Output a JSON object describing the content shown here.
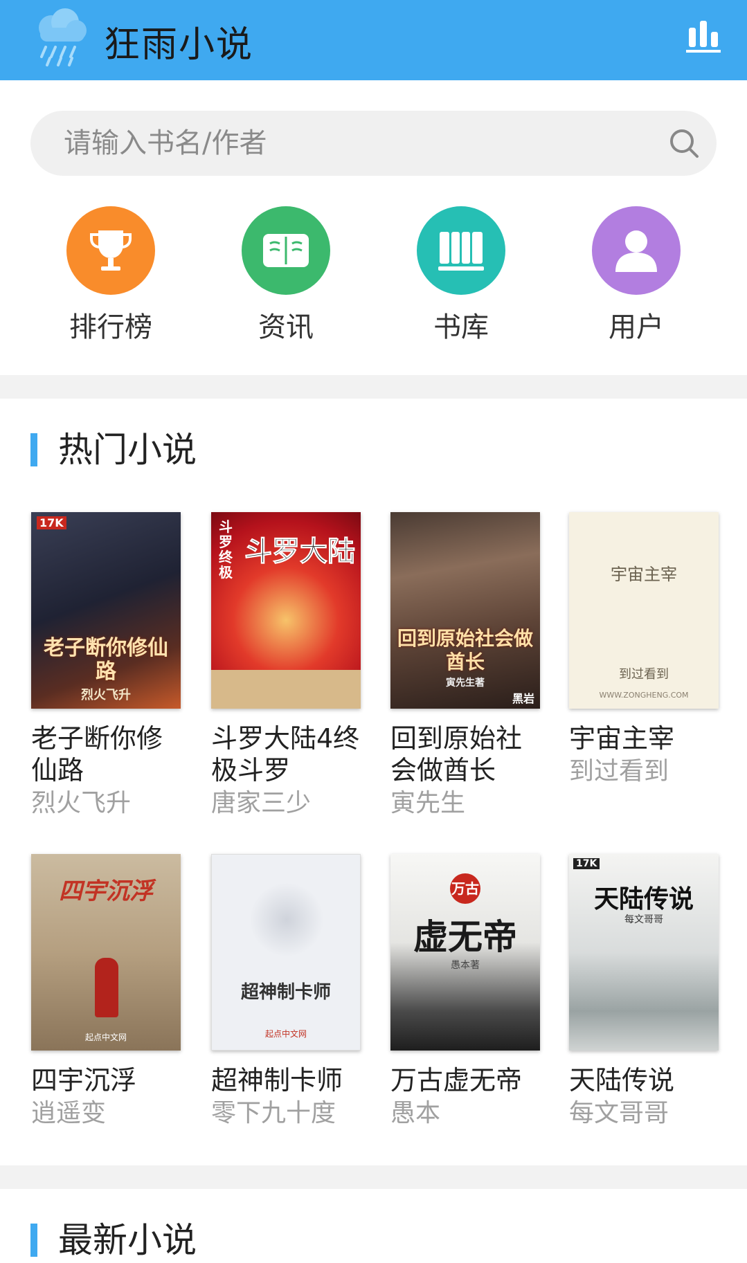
{
  "app": {
    "title": "狂雨小说"
  },
  "search": {
    "placeholder": "请输入书名/作者"
  },
  "nav": [
    {
      "label": "排行榜",
      "icon": "trophy-icon",
      "color": "#f98c2b"
    },
    {
      "label": "资讯",
      "icon": "book-open-icon",
      "color": "#3cb96d"
    },
    {
      "label": "书库",
      "icon": "bookshelf-icon",
      "color": "#26bfb4"
    },
    {
      "label": "用户",
      "icon": "user-icon",
      "color": "#b27ee0"
    }
  ],
  "sections": {
    "hot": "热门小说",
    "latest": "最新小说"
  },
  "hot_books": [
    {
      "title": "老子断你修仙路",
      "author": "烈火飞升",
      "cover_text": "老子断你修仙路",
      "cover_sub": "烈火飞升",
      "cover_badge": "17K"
    },
    {
      "title": "斗罗大陆4终极斗罗",
      "author": "唐家三少",
      "cover_text": "斗罗大陆",
      "cover_sub": "斗罗 终极",
      "cover_badge": ""
    },
    {
      "title": "回到原始社会做酋长",
      "author": "寅先生",
      "cover_text": "回到原始社会做酋长",
      "cover_sub": "寅先生著",
      "cover_badge": "黑岩"
    },
    {
      "title": "宇宙主宰",
      "author": "到过看到",
      "cover_text": "宇宙主宰",
      "cover_sub": "到过看到",
      "cover_badge": "WWW.ZONGHENG.COM"
    },
    {
      "title": "四宇沉浮",
      "author": "逍遥变",
      "cover_text": "四宇沉浮",
      "cover_sub": "起点中文网",
      "cover_badge": ""
    },
    {
      "title": "超神制卡师",
      "author": "零下九十度",
      "cover_text": "超神制卡师",
      "cover_sub": "起点中文网",
      "cover_badge": ""
    },
    {
      "title": "万古虚无帝",
      "author": "愚本",
      "cover_text": "虚无帝",
      "cover_sub": "万古",
      "cover_badge": "愚本著"
    },
    {
      "title": "天陆传说",
      "author": "每文哥哥",
      "cover_text": "天陆传说",
      "cover_sub": "每文哥哥",
      "cover_badge": "17K"
    }
  ]
}
